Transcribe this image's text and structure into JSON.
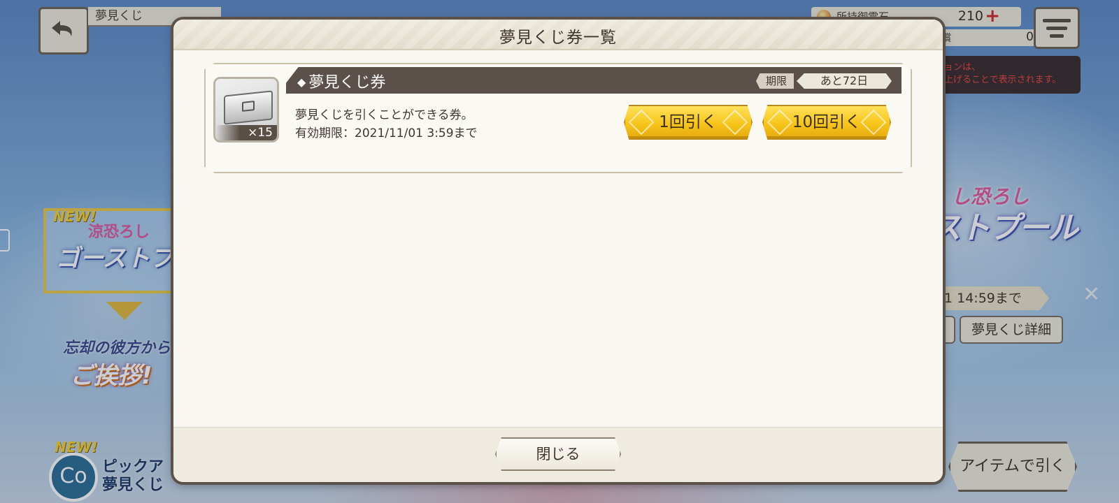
{
  "background": {
    "screen_title": "夢見くじ",
    "currency": {
      "label": "所持御霊石",
      "value": "210",
      "paid_label": "有償",
      "paid_value": "0"
    },
    "notice": {
      "line1": "ョンは、",
      "line2": "上げることで表示されます。"
    },
    "right_banner": {
      "top_text": "し恐ろし",
      "main_text": "ストプール"
    },
    "left_banner": {
      "new_tag": "NEW!",
      "top_text": "涼恐ろし",
      "main_text": "ゴーストプール"
    },
    "left_banner2": {
      "small_text": "忘却の彼方から",
      "main_text": "ご挨拶!"
    },
    "pickup": {
      "new_tag": "NEW!",
      "line1": "ピックア",
      "line2": "夢見くじ",
      "badge": "Co"
    },
    "end_date": "1 14:59まで",
    "detail_button": "夢見くじ詳細",
    "item_button": "アイテムで引く"
  },
  "modal": {
    "title": "夢見くじ券一覧",
    "close_label": "閉じる",
    "tickets": [
      {
        "name": "夢見くじ券",
        "diamond": "◆",
        "limit_label": "期限",
        "limit_value": "あと72日",
        "count": "×15",
        "description": "夢見くじを引くことができる券。",
        "expiry": "有効期限：2021/11/01 3:59まで",
        "draw_one_label": "1回引く",
        "draw_ten_label": "10回引く"
      }
    ]
  },
  "colors": {
    "accent_gold": "#f7c51a",
    "header_dark": "#5c514a",
    "plus_red": "#d2242a"
  }
}
